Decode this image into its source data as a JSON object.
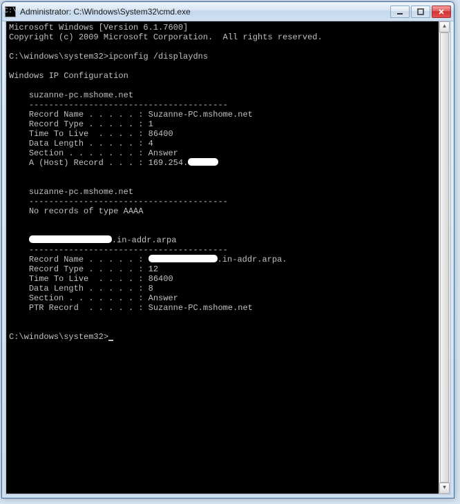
{
  "window": {
    "icon_text": "C:\\",
    "title": "Administrator: C:\\Windows\\System32\\cmd.exe"
  },
  "console": {
    "banner1": "Microsoft Windows [Version 6.1.7600]",
    "banner2": "Copyright (c) 2009 Microsoft Corporation.  All rights reserved.",
    "prompt1_path": "C:\\windows\\system32>",
    "prompt1_cmd": "ipconfig /displaydns",
    "heading": "Windows IP Configuration",
    "section1": {
      "host": "suzanne-pc.mshome.net",
      "divider": "----------------------------------------",
      "rec_name_label": "Record Name . . . . . :",
      "rec_name_value": "Suzanne-PC.mshome.net",
      "rec_type_label": "Record Type . . . . . :",
      "rec_type_value": "1",
      "ttl_label": "Time To Live  . . . . :",
      "ttl_value": "86400",
      "dlen_label": "Data Length . . . . . :",
      "dlen_value": "4",
      "section_label": "Section . . . . . . . :",
      "section_value": "Answer",
      "ahost_label": "A (Host) Record . . . :",
      "ahost_value": "169.254."
    },
    "section2": {
      "host": "suzanne-pc.mshome.net",
      "divider": "----------------------------------------",
      "norec": "No records of type AAAA"
    },
    "section3": {
      "host_suffix": ".in-addr.arpa",
      "divider": "----------------------------------------",
      "rec_name_label": "Record Name . . . . . :",
      "rec_name_suffix": ".in-addr.arpa.",
      "rec_type_label": "Record Type . . . . . :",
      "rec_type_value": "12",
      "ttl_label": "Time To Live  . . . . :",
      "ttl_value": "86400",
      "dlen_label": "Data Length . . . . . :",
      "dlen_value": "8",
      "section_label": "Section . . . . . . . :",
      "section_value": "Answer",
      "ptr_label": "PTR Record  . . . . . :",
      "ptr_value": "Suzanne-PC.mshome.net"
    },
    "prompt2_path": "C:\\windows\\system32>"
  }
}
